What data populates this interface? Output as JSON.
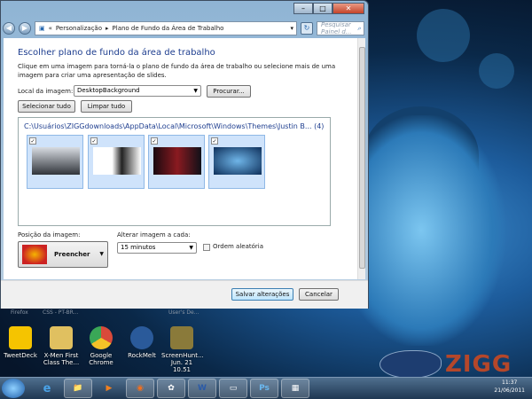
{
  "window": {
    "breadcrumb": [
      "Personalização",
      "Plano de Fundo da Área de Trabalho"
    ],
    "search_placeholder": "Pesquisar Painel d...",
    "title": "Escolher plano de fundo da área de trabalho",
    "description": "Clique em uma imagem para torná-la o plano de fundo da área de trabalho ou selecione mais de uma imagem para criar uma apresentação de slides.",
    "location_label": "Local da imagem:",
    "location_value": "DesktopBackground",
    "browse": "Procurar...",
    "select_all": "Selecionar tudo",
    "clear_all": "Limpar tudo",
    "folder_path": "C:\\Usuários\\ZIGGdownloads\\AppData\\Local\\Microsoft\\Windows\\Themes\\Justin B... (4)",
    "thumbnails": [
      {
        "checked": true
      },
      {
        "checked": true
      },
      {
        "checked": true
      },
      {
        "checked": true
      }
    ],
    "position_label": "Posição da imagem:",
    "position_value": "Preencher",
    "interval_label": "Alterar imagem a cada:",
    "interval_value": "15 minutos",
    "shuffle_label": "Ordem aleatória",
    "shuffle_checked": false,
    "save": "Salvar alterações",
    "cancel": "Cancelar"
  },
  "desktop": {
    "ghost_labels": [
      "Firefox",
      "CSS - PT-BR...",
      "User's De..."
    ],
    "icons": [
      {
        "label": "TweetDeck",
        "color": "#f5c400"
      },
      {
        "label": "X-Men First Class The...",
        "color": "#e0c060"
      },
      {
        "label": "Google Chrome",
        "color": "#d94a3a"
      },
      {
        "label": "RockMelt",
        "color": "#2a5a9a"
      },
      {
        "label": "ScreenHunt... Jun. 21 10.51",
        "color": "#8a7a3a"
      }
    ]
  },
  "taskbar": {
    "items": [
      {
        "icon": "internet-explorer-icon",
        "glyph": "e"
      },
      {
        "icon": "explorer-icon",
        "glyph": "📁"
      },
      {
        "icon": "media-player-icon",
        "glyph": "▶"
      },
      {
        "icon": "firefox-icon",
        "glyph": "◉"
      },
      {
        "icon": "app-icon",
        "glyph": "✿"
      },
      {
        "icon": "word-icon",
        "glyph": "W"
      },
      {
        "icon": "window-icon",
        "glyph": "▭"
      },
      {
        "icon": "photoshop-icon",
        "glyph": "Ps"
      },
      {
        "icon": "control-panel-icon",
        "glyph": "▦"
      }
    ],
    "time": "11:37",
    "date": "21/06/2011"
  },
  "watermark": "ZIGG"
}
